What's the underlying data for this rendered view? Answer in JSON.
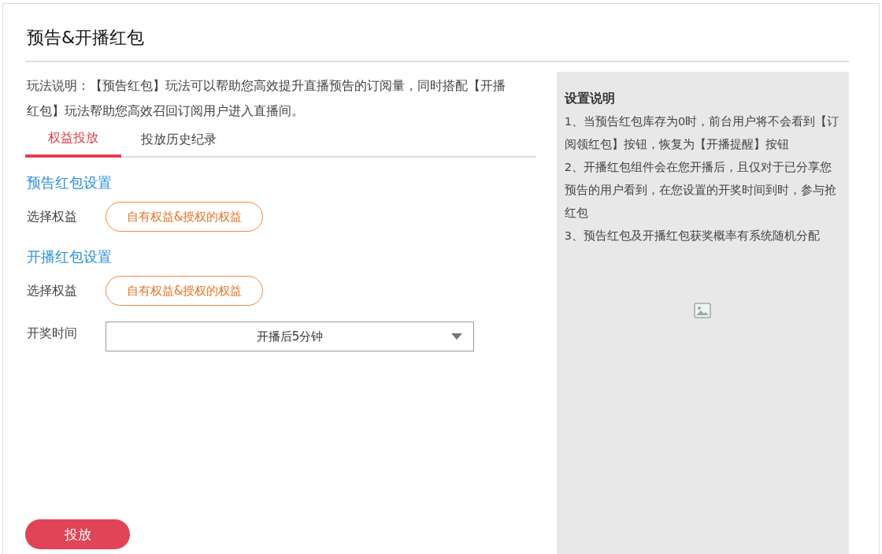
{
  "page": {
    "title": "预告&开播红包"
  },
  "intro": "玩法说明：【预告红包】玩法可以帮助您高效提升直播预告的订阅量，同时搭配【开播红包】玩法帮助您高效召回订阅用户进入直播间。",
  "tabs": [
    {
      "label": "权益投放",
      "selected": true
    },
    {
      "label": "投放历史纪录",
      "selected": false
    }
  ],
  "sections": [
    {
      "title": "预告红包设置",
      "fields": [
        {
          "kind": "pill",
          "label": "选择权益",
          "value": "自有权益&授权的权益"
        }
      ]
    },
    {
      "title": "开播红包设置",
      "fields": [
        {
          "kind": "pill",
          "label": "选择权益",
          "value": "自有权益&授权的权益"
        },
        {
          "kind": "select",
          "label": "开奖时间",
          "value": "开播后5分钟"
        }
      ]
    }
  ],
  "submit_button": "投放",
  "side_panel": {
    "title": "设置说明",
    "notes": [
      "1、当预告红包库存为0时，前台用户将不会看到【订阅领红包】按钮，恢复为【开播提醒】按钮",
      "2、开播红包组件会在您开播后，且仅对于已分享您预告的用户看到，在您设置的开奖时间到时，参与抢红包",
      "3、预告红包及开播红包获奖概率有系统随机分配"
    ]
  }
}
